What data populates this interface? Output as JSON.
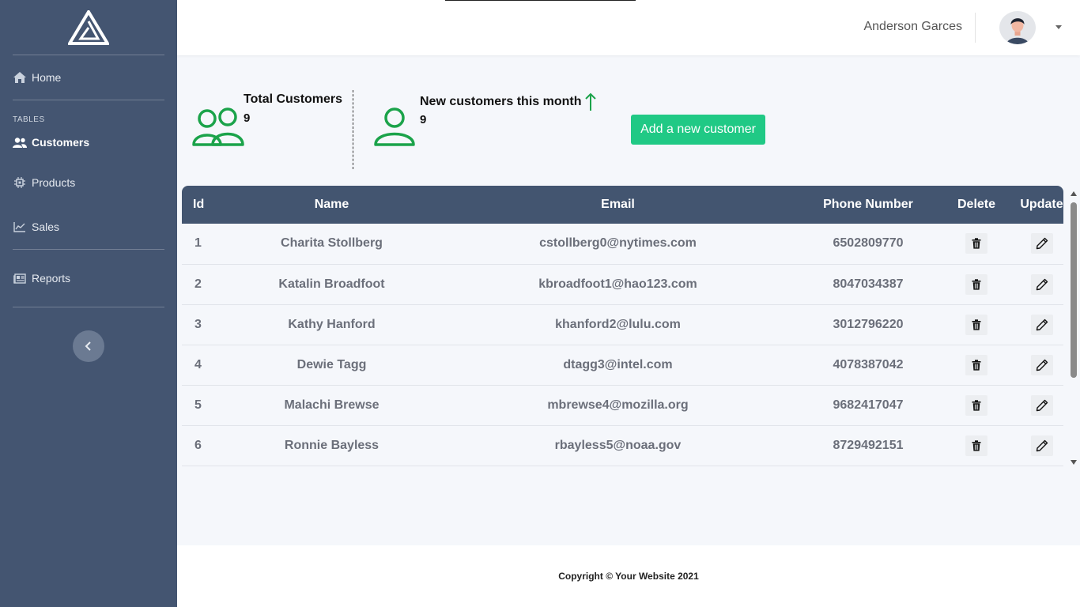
{
  "sidebar": {
    "items": [
      {
        "label": "Home",
        "icon": "home-icon"
      },
      {
        "label": "Customers",
        "icon": "users-icon"
      },
      {
        "label": "Products",
        "icon": "chip-icon"
      },
      {
        "label": "Sales",
        "icon": "chart-line-icon"
      },
      {
        "label": "Reports",
        "icon": "newspaper-icon"
      }
    ],
    "section_heading": "TABLES"
  },
  "topbar": {
    "user_name": "Anderson Garces"
  },
  "stats": {
    "total_label": "Total Customers",
    "total_value": "9",
    "new_label": "New customers this month",
    "new_value": "9"
  },
  "add_button_label": "Add a new customer",
  "table": {
    "headers": [
      "Id",
      "Name",
      "Email",
      "Phone Number",
      "Delete",
      "Update"
    ],
    "rows": [
      {
        "id": "1",
        "name": "Charita Stollberg",
        "email": "cstollberg0@nytimes.com",
        "phone": "6502809770"
      },
      {
        "id": "2",
        "name": "Katalin Broadfoot",
        "email": "kbroadfoot1@hao123.com",
        "phone": "8047034387"
      },
      {
        "id": "3",
        "name": "Kathy Hanford",
        "email": "khanford2@lulu.com",
        "phone": "3012796220"
      },
      {
        "id": "4",
        "name": "Dewie Tagg",
        "email": "dtagg3@intel.com",
        "phone": "4078387042"
      },
      {
        "id": "5",
        "name": "Malachi Brewse",
        "email": "mbrewse4@mozilla.org",
        "phone": "9682417047"
      },
      {
        "id": "6",
        "name": "Ronnie Bayless",
        "email": "rbayless5@noaa.gov",
        "phone": "8729492151"
      }
    ]
  },
  "footer": {
    "text": "Copyright © Your Website 2021"
  },
  "colors": {
    "sidebar_bg": "#445571",
    "table_header_bg": "#435570",
    "accent_green": "#20c985",
    "icon_green": "#1ba34a"
  }
}
